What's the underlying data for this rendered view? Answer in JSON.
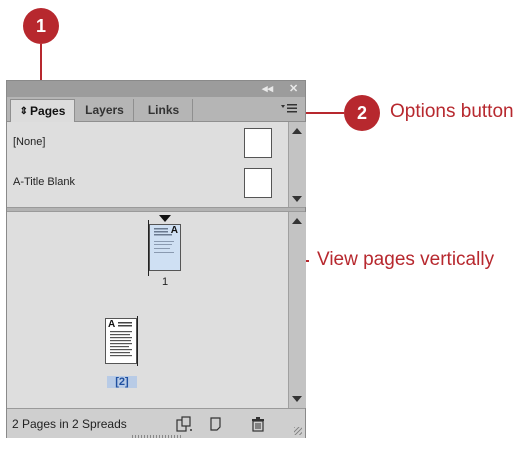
{
  "callouts": [
    {
      "number": "1"
    },
    {
      "number": "2",
      "label": "Options button"
    },
    {
      "label": "View pages vertically"
    }
  ],
  "panel": {
    "tabs": [
      {
        "label": "Pages",
        "active": true
      },
      {
        "label": "Layers",
        "active": false
      },
      {
        "label": "Links",
        "active": false
      }
    ],
    "title_controls": {
      "collapse": "◂◂",
      "close": "✕"
    },
    "masters": [
      {
        "label": "[None]"
      },
      {
        "label": "A-Title Blank"
      }
    ],
    "pages": [
      {
        "number": "1",
        "master_prefix": "A",
        "selected": false
      },
      {
        "number": "[2]",
        "master_prefix": "A",
        "selected": true
      }
    ],
    "status": "2 Pages in 2 Spreads",
    "colors": {
      "accent": "#b7282e",
      "selection": "#b8cbe6"
    }
  }
}
